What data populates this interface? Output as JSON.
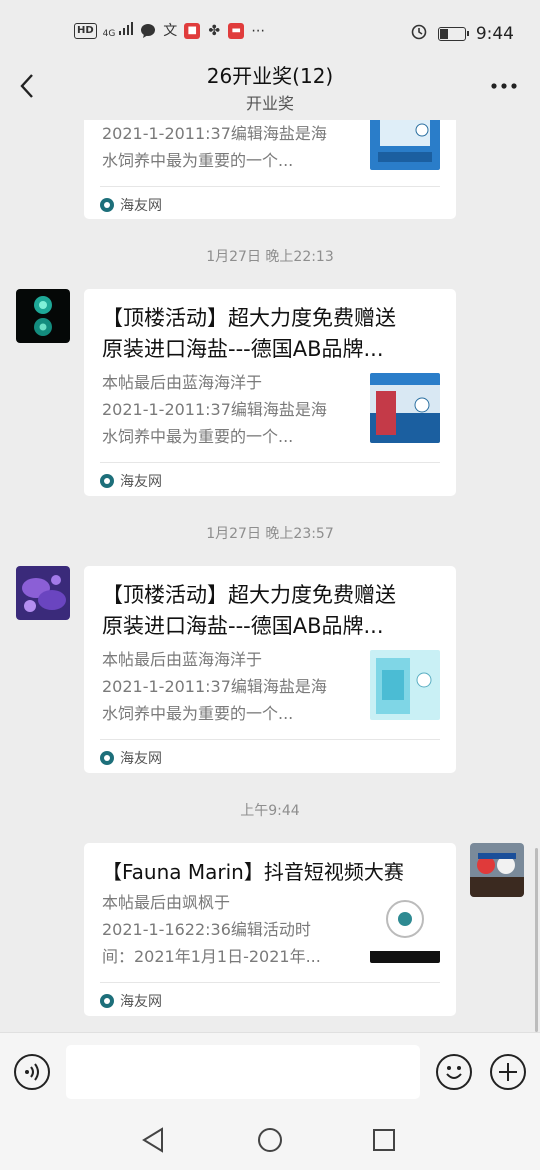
{
  "status_bar": {
    "hd": "HD",
    "signal": "4G",
    "time": "9:44",
    "icons": [
      "hd-icon",
      "signal-icon",
      "chat-bubble-icon",
      "translate-icon",
      "red-app-icon",
      "weibo-icon",
      "news-icon",
      "more-dots-icon",
      "alarm-icon",
      "battery-icon"
    ]
  },
  "header": {
    "title": "26开业奖(12)",
    "subtitle": "开业奖",
    "back_icon": "chevron-left-icon",
    "more_icon": "more-icon"
  },
  "messages": [
    {
      "type": "card-partial",
      "desc": "2021-1-2011:37编辑海盐是海水饲养中最为重要的一个...",
      "desc_lines": [
        "2021-1-2011:37编辑海盐是海",
        "水饲养中最为重要的一个..."
      ],
      "source": "海友网"
    },
    {
      "type": "card",
      "timestamp": "1月27日 晚上22:13",
      "title_lines": [
        "【顶楼活动】超大力度免费赠送",
        "原装进口海盐---德国AB品牌..."
      ],
      "desc_lines": [
        "本帖最后由蓝海海洋于",
        "2021-1-2011:37编辑海盐是海",
        "水饲养中最为重要的一个..."
      ],
      "source": "海友网"
    },
    {
      "type": "card",
      "timestamp": "1月27日 晚上23:57",
      "title_lines": [
        "【顶楼活动】超大力度免费赠送",
        "原装进口海盐---德国AB品牌..."
      ],
      "desc_lines": [
        "本帖最后由蓝海海洋于",
        "2021-1-2011:37编辑海盐是海",
        "水饲养中最为重要的一个..."
      ],
      "source": "海友网"
    },
    {
      "type": "card",
      "timestamp": "上午9:44",
      "title_lines": [
        "【Fauna Marin】抖音短视频大赛"
      ],
      "desc_lines": [
        "本帖最后由飒枫于",
        "2021-1-1622:36编辑活动时",
        "间：2021年1月1日-2021年..."
      ],
      "source": "海友网"
    }
  ],
  "input_bar": {
    "voice_icon": "voice-icon",
    "emoji_icon": "emoji-icon",
    "add_icon": "plus-icon",
    "value": ""
  },
  "system_nav": [
    "back-triangle-icon",
    "home-circle-icon",
    "recents-square-icon"
  ]
}
